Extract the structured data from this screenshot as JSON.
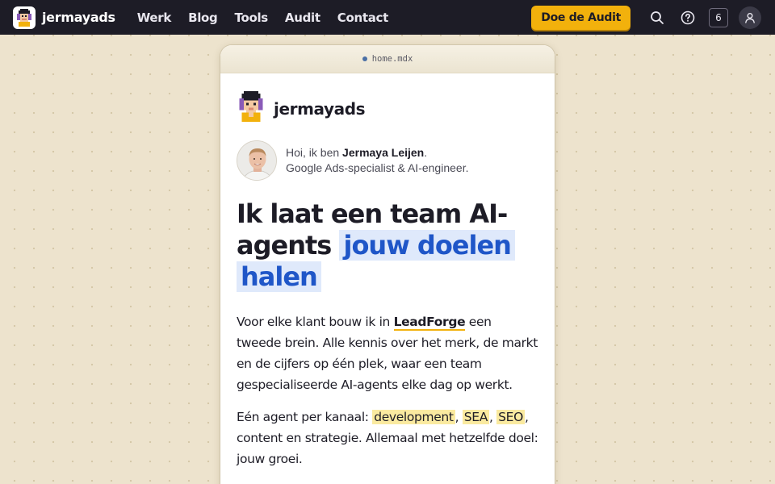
{
  "nav": {
    "brand": "jermayads",
    "links": [
      "Werk",
      "Blog",
      "Tools",
      "Audit",
      "Contact"
    ],
    "cta_label": "Doe de Audit",
    "count": "6",
    "icons": [
      "search-icon",
      "help-icon",
      "user-icon"
    ]
  },
  "card": {
    "file_name": "home.mdx",
    "logo_text": "jermayads",
    "intro": {
      "greeting": "Hoi, ik ben ",
      "name": "Jermaya Leijen",
      "period": ".",
      "role": "Google Ads-specialist & AI-engineer."
    },
    "headline": {
      "plain": "Ik laat een team AI-agents ",
      "highlight": "jouw doelen halen"
    },
    "para1": {
      "before": "Voor elke klant bouw ik in ",
      "link": "LeadForge",
      "after": " een tweede brein. Alle kennis over het merk, de markt en de cijfers op één plek, waar een team gespecialiseerde AI-agents elke dag op werkt."
    },
    "para2": {
      "before": "Eén agent per kanaal: ",
      "tag1": "development",
      "sep1": ", ",
      "tag2": "SEA",
      "sep2": ", ",
      "tag3": "SEO",
      "after": ", content en strategie. Allemaal met hetzelfde doel: jouw groei."
    }
  },
  "colors": {
    "nav_bg": "#1d1c26",
    "accent": "#f2b10c",
    "page_bg": "#ede3cd",
    "highlight_text": "#1f56c8",
    "highlight_bg": "#dfe9fb",
    "tag_bg": "#faeaa0"
  }
}
